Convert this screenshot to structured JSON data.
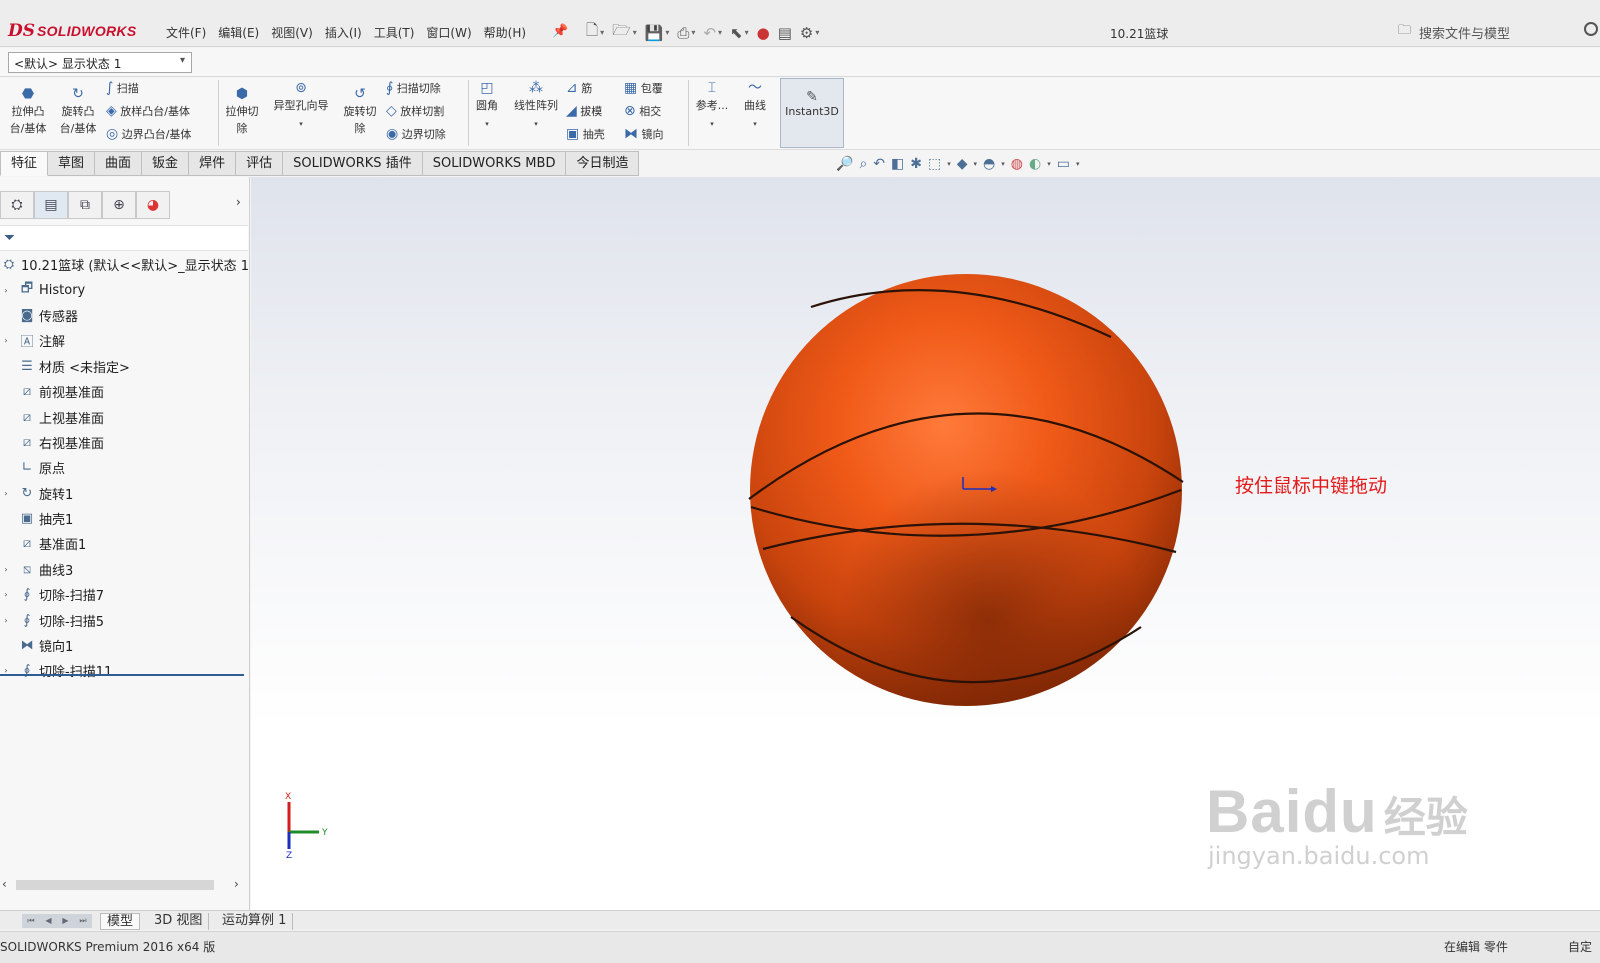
{
  "app": {
    "logo_prefix": "DS",
    "logo_text": "SOLIDWORKS",
    "doc_title": "10.21篮球",
    "search_placeholder": "搜索文件与模型"
  },
  "menu": [
    "文件(F)",
    "编辑(E)",
    "视图(V)",
    "插入(I)",
    "工具(T)",
    "窗口(W)",
    "帮助(H)"
  ],
  "config": {
    "value": "<默认> 显示状态 1"
  },
  "commands": {
    "extrude_boss": "拉伸凸台/基体",
    "revolve_boss": "旋转凸台/基体",
    "sweep": "扫描",
    "loft_boss": "放样凸台/基体",
    "boundary_boss": "边界凸台/基体",
    "extrude_cut": "拉伸切除",
    "hole_wizard": "异型孔向导",
    "revolve_cut": "旋转切除",
    "swept_cut": "扫描切除",
    "lofted_cut": "放样切割",
    "boundary_cut": "边界切除",
    "fillet": "圆角",
    "linear_pattern": "线性阵列",
    "rib": "筋",
    "draft": "拔模",
    "shell": "抽壳",
    "wrap": "包覆",
    "intersect": "相交",
    "mirror": "镜向",
    "reference": "参考...",
    "curves": "曲线",
    "instant3d": "Instant3D"
  },
  "tabs": [
    {
      "label": "特征",
      "active": true
    },
    {
      "label": "草图",
      "active": false
    },
    {
      "label": "曲面",
      "active": false
    },
    {
      "label": "钣金",
      "active": false
    },
    {
      "label": "焊件",
      "active": false
    },
    {
      "label": "评估",
      "active": false
    },
    {
      "label": "SOLIDWORKS 插件",
      "active": false
    },
    {
      "label": "SOLIDWORKS MBD",
      "active": false
    },
    {
      "label": "今日制造",
      "active": false
    }
  ],
  "tree": {
    "root": "10.21篮球 (默认<<默认>_显示状态 1",
    "items": [
      {
        "label": "History",
        "icon": "history-icon",
        "expandable": true
      },
      {
        "label": "传感器",
        "icon": "sensor-icon",
        "expandable": false
      },
      {
        "label": "注解",
        "icon": "annotation-icon",
        "expandable": true
      },
      {
        "label": "材质 <未指定>",
        "icon": "material-icon",
        "expandable": false
      },
      {
        "label": "前视基准面",
        "icon": "plane-icon",
        "expandable": false
      },
      {
        "label": "上视基准面",
        "icon": "plane-icon",
        "expandable": false
      },
      {
        "label": "右视基准面",
        "icon": "plane-icon",
        "expandable": false
      },
      {
        "label": "原点",
        "icon": "origin-icon",
        "expandable": false
      },
      {
        "label": "旋转1",
        "icon": "revolve-icon",
        "expandable": true
      },
      {
        "label": "抽壳1",
        "icon": "shell-icon",
        "expandable": false
      },
      {
        "label": "基准面1",
        "icon": "plane-icon",
        "expandable": false
      },
      {
        "label": "曲线3",
        "icon": "curve-icon",
        "expandable": true
      },
      {
        "label": "切除-扫描7",
        "icon": "sweep-cut-icon",
        "expandable": true
      },
      {
        "label": "切除-扫描5",
        "icon": "sweep-cut-icon",
        "expandable": true
      },
      {
        "label": "镜向1",
        "icon": "mirror-icon",
        "expandable": false
      },
      {
        "label": "切除-扫描11",
        "icon": "sweep-cut-icon",
        "expandable": true
      }
    ]
  },
  "annotation": {
    "hint": "按住鼠标中键拖动"
  },
  "triad": {
    "x": "X",
    "y": "Y",
    "z": "Z"
  },
  "watermark": {
    "main": "Bai",
    "paw": "du",
    "cn": "经验",
    "url": "jingyan.baidu.com"
  },
  "bottom_tabs": [
    {
      "label": "模型",
      "active": true
    },
    {
      "label": "3D 视图",
      "active": false
    },
    {
      "label": "运动算例 1",
      "active": false
    }
  ],
  "status": {
    "left": "SOLIDWORKS Premium 2016 x64 版",
    "mid": "在编辑 零件",
    "right": "自定"
  },
  "colors": {
    "ball": "#e8520f",
    "ball_dark": "#8a2a06",
    "hint": "#e31a1a",
    "accent": "#2e5d93"
  }
}
